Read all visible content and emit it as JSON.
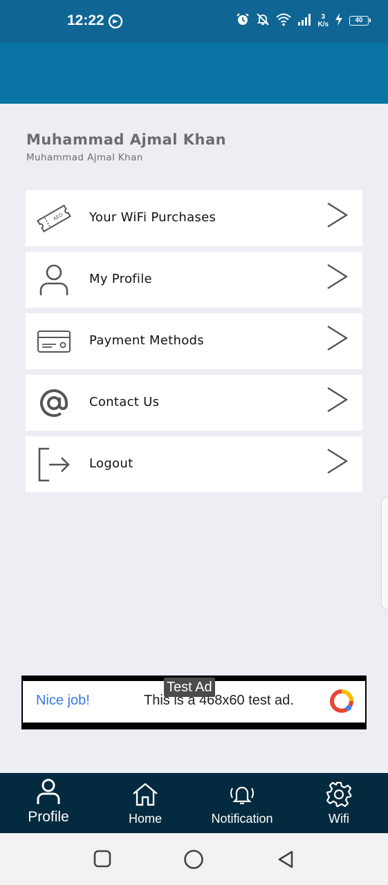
{
  "status_bar": {
    "time": "12:22",
    "speed_value": "3",
    "speed_unit": "K/s",
    "battery": "40"
  },
  "user": {
    "name": "Muhammad Ajmal Khan",
    "subtitle": "Muhammad Ajmal Khan"
  },
  "menu": {
    "items": [
      {
        "label": "Your WiFi Purchases",
        "icon": "ticket-icon"
      },
      {
        "label": "My Profile",
        "icon": "person-icon"
      },
      {
        "label": "Payment Methods",
        "icon": "credit-card-icon"
      },
      {
        "label": "Contact Us",
        "icon": "at-sign-icon"
      },
      {
        "label": "Logout",
        "icon": "logout-icon"
      }
    ]
  },
  "ad": {
    "tag": "Test Ad",
    "nice": "Nice job!",
    "text": "This is a 468x60 test ad."
  },
  "bottom_nav": {
    "items": [
      {
        "label": "Profile",
        "icon": "person-icon",
        "active": true
      },
      {
        "label": "Home",
        "icon": "home-icon",
        "active": false
      },
      {
        "label": "Notification",
        "icon": "bell-icon",
        "active": false
      },
      {
        "label": "Wifi",
        "icon": "gear-icon",
        "active": false
      }
    ]
  },
  "colors": {
    "status_bar": "#0f6694",
    "header": "#0973a3",
    "bottom_nav": "#032a3e",
    "background": "#eceef3"
  }
}
